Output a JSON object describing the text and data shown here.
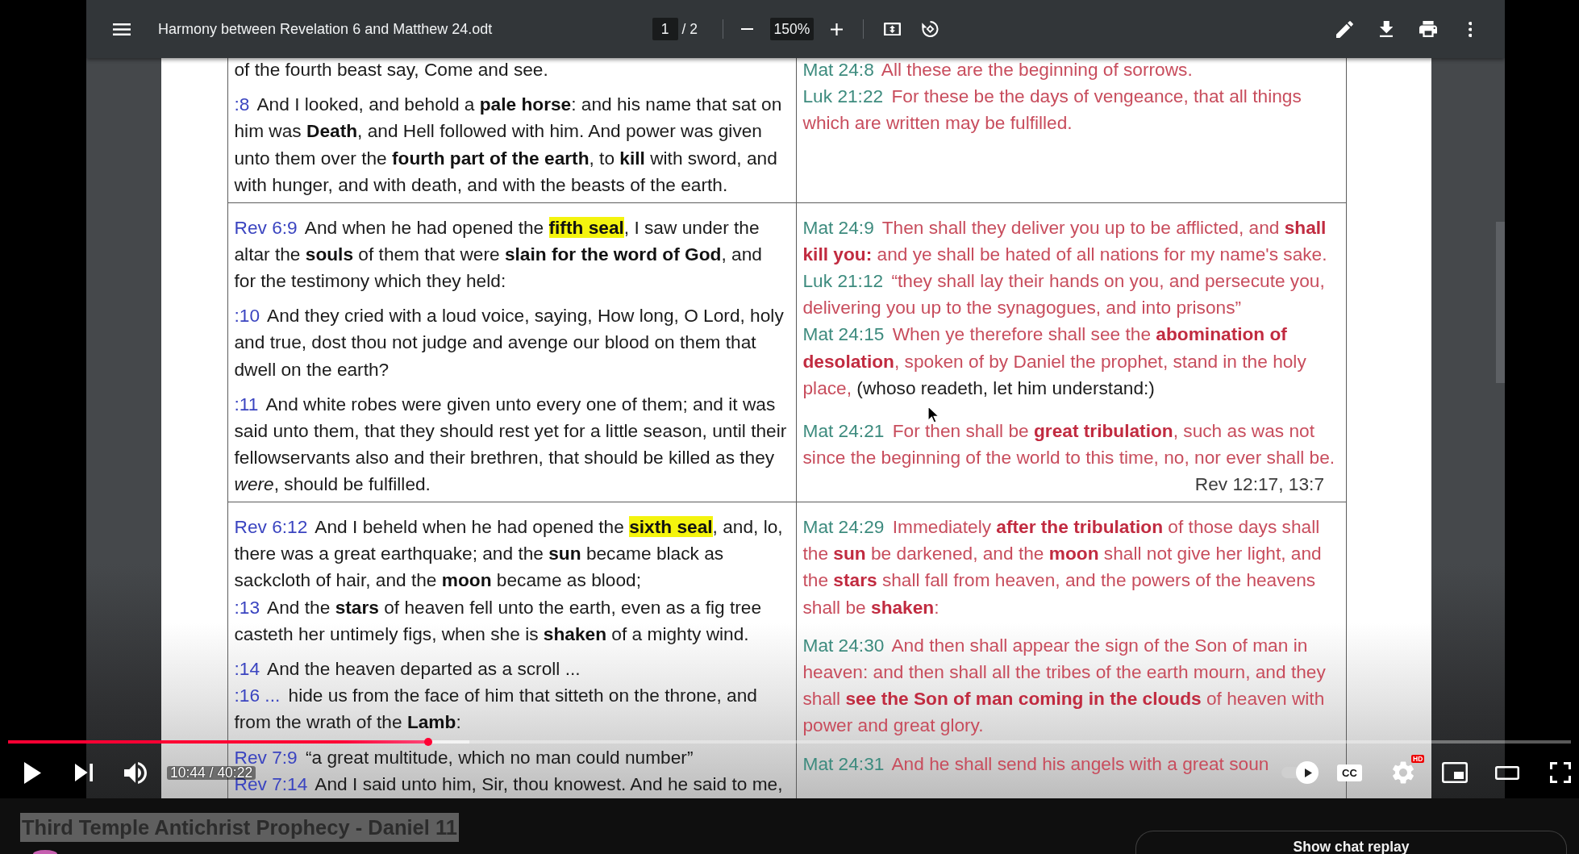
{
  "viewer": {
    "title": "Harmony between Revelation 6 and Matthew 24.odt",
    "page": "1",
    "page_total": "/ 2",
    "zoom": "150%"
  },
  "document": {
    "rows": [
      {
        "left": [
          {
            "verses": [
              {
                "kind": "verse",
                "parts": [
                  {
                    "kind": "plain",
                    "text": "of the fourth beast say, Come and see."
                  }
                ]
              }
            ]
          },
          {
            "verses": [
              {
                "kind": "verse",
                "ref": ":8",
                "parts": [
                  {
                    "kind": "plain",
                    "text": "And I looked, and behold a **pale horse**: and his name that sat on him was **Death**, and Hell followed with him. And power was given unto them over the **fourth part of the earth**, to **kill** with sword, and with hunger, and with death, and with the beasts of the earth."
                  }
                ]
              }
            ]
          }
        ],
        "right": [
          {
            "verses": [
              {
                "kind": "verse",
                "ref": "Mat 24:8",
                "parts": [
                  {
                    "kind": "plain",
                    "text": "All these are the beginning of sorrows."
                  }
                ]
              },
              {
                "kind": "verse",
                "ref": "Luk 21:22",
                "parts": [
                  {
                    "kind": "plain",
                    "text": "For these be the days of vengeance, that all things which are written may be fulfilled."
                  }
                ]
              }
            ]
          }
        ]
      },
      {
        "left": [
          {
            "verses": [
              {
                "kind": "verse",
                "ref": "Rev 6:9",
                "parts": [
                  {
                    "kind": "plain",
                    "text": "And when he had opened the "
                  },
                  {
                    "kind": "highlight",
                    "text": "**fifth seal**"
                  },
                  {
                    "kind": "plain",
                    "text": ", I saw under the altar the **souls** of them that were **slain for the word of God**, and for the testimony which they held:"
                  }
                ]
              }
            ]
          },
          {
            "verses": [
              {
                "kind": "verse",
                "ref": ":10",
                "parts": [
                  {
                    "kind": "plain",
                    "text": "And they cried with a loud voice, saying, How long, O Lord, holy and true, dost thou not judge and avenge our blood on them that dwell on the earth?"
                  }
                ]
              }
            ]
          },
          {
            "verses": [
              {
                "kind": "verse",
                "ref": ":11",
                "parts": [
                  {
                    "kind": "plain",
                    "text": "And white robes were given unto every one of them; and it was said unto them, that they should rest yet for a little season, until their fellowservants also and their brethren, that should be killed as they *were*, should be fulfilled."
                  }
                ]
              }
            ]
          }
        ],
        "right": [
          {
            "verses": [
              {
                "kind": "verse",
                "ref": "Mat 24:9",
                "parts": [
                  {
                    "kind": "plain",
                    "text": "Then shall they deliver you up to be afflicted, and **shall kill you:** and ye shall be hated of all nations for my name's sake."
                  }
                ]
              },
              {
                "kind": "verse",
                "ref": "Luk 21:12",
                "parts": [
                  {
                    "kind": "plain",
                    "text": "“they shall lay their hands on you, and persecute you, delivering you up to the synagogues, and into prisons”"
                  }
                ]
              },
              {
                "kind": "verse",
                "ref": "Mat 24:15",
                "parts": [
                  {
                    "kind": "plain",
                    "text": "When ye therefore shall see the **abomination of desolation**, spoken of by Daniel the prophet, stand in the holy place, "
                  },
                  {
                    "kind": "note",
                    "text": "(whoso readeth, let him understand:)"
                  }
                ]
              }
            ]
          },
          {
            "verses": [
              {
                "kind": "verse",
                "ref": "Mat 24:21",
                "parts": [
                  {
                    "kind": "plain",
                    "text": "For then shall be **great tribulation**, such as was not since the beginning of the world to this time, no, nor ever shall be."
                  }
                ]
              },
              {
                "kind": "crossref",
                "text": "Rev 12:17, 13:7"
              }
            ]
          }
        ]
      },
      {
        "left": [
          {
            "verses": [
              {
                "kind": "verse",
                "ref": "Rev 6:12",
                "parts": [
                  {
                    "kind": "plain",
                    "text": "And I beheld when he had opened the "
                  },
                  {
                    "kind": "highlight",
                    "text": "**sixth seal**"
                  },
                  {
                    "kind": "plain",
                    "text": ", and, lo, there was a great earthquake; and the **sun** became black as sackcloth of hair, and the **moon** became as blood;"
                  }
                ]
              },
              {
                "kind": "verse",
                "ref": ":13",
                "parts": [
                  {
                    "kind": "plain",
                    "text": "And the **stars** of heaven fell unto the earth, even as a fig tree casteth her untimely figs, when she is **shaken** of a mighty wind."
                  }
                ]
              }
            ]
          },
          {
            "verses": [
              {
                "kind": "verse",
                "ref": ":14",
                "parts": [
                  {
                    "kind": "plain",
                    "text": "And the heaven departed as a scroll ..."
                  }
                ]
              },
              {
                "kind": "verse",
                "ref": ":16 ...",
                "parts": [
                  {
                    "kind": "plain",
                    "text": "hide us from the face of him that sitteth on the throne, and from the wrath of the **Lamb**:"
                  }
                ]
              }
            ]
          },
          {
            "verses": [
              {
                "kind": "verse",
                "ref": "Rev 7:9",
                "parts": [
                  {
                    "kind": "plain",
                    "text": "“a great multitude, which no man could number”"
                  }
                ]
              },
              {
                "kind": "verse",
                "ref": "Rev 7:14",
                "parts": [
                  {
                    "kind": "plain",
                    "text": "And I said unto him, Sir, thou knowest. And he said to me,"
                  }
                ]
              }
            ]
          }
        ],
        "right": [
          {
            "verses": [
              {
                "kind": "verse",
                "ref": "Mat 24:29",
                "parts": [
                  {
                    "kind": "plain",
                    "text": "Immediately **after the tribulation** of those days shall the **sun** be darkened, and the **moon** shall not give her light, and the **stars** shall fall from heaven, and the powers of the heavens shall be **shaken**:"
                  }
                ]
              }
            ]
          },
          {
            "verses": [
              {
                "kind": "verse",
                "ref": "Mat 24:30",
                "parts": [
                  {
                    "kind": "plain",
                    "text": "And then shall appear the sign of the Son of man in heaven: and then shall all the tribes of the earth mourn, and they shall **see the Son of man coming in the clouds** of heaven with power and great glory."
                  }
                ]
              }
            ]
          },
          {
            "verses": [
              {
                "kind": "verse",
                "ref": "Mat 24:31",
                "parts": [
                  {
                    "kind": "plain",
                    "text": "And he shall send his angels with a great soun"
                  }
                ]
              }
            ]
          }
        ]
      }
    ]
  },
  "player": {
    "progress": {
      "level": 0.269,
      "buffer": {
        "level": 0.295
      }
    },
    "time": "10:44 / 40:22",
    "autoplay": {
      "on": true
    },
    "captions": "CC",
    "quality": "HD"
  },
  "video": {
    "title": "Third Temple Antichrist Prophecy - Daniel 11",
    "highlighted": true
  },
  "chat": {
    "button": "Show chat replay"
  }
}
